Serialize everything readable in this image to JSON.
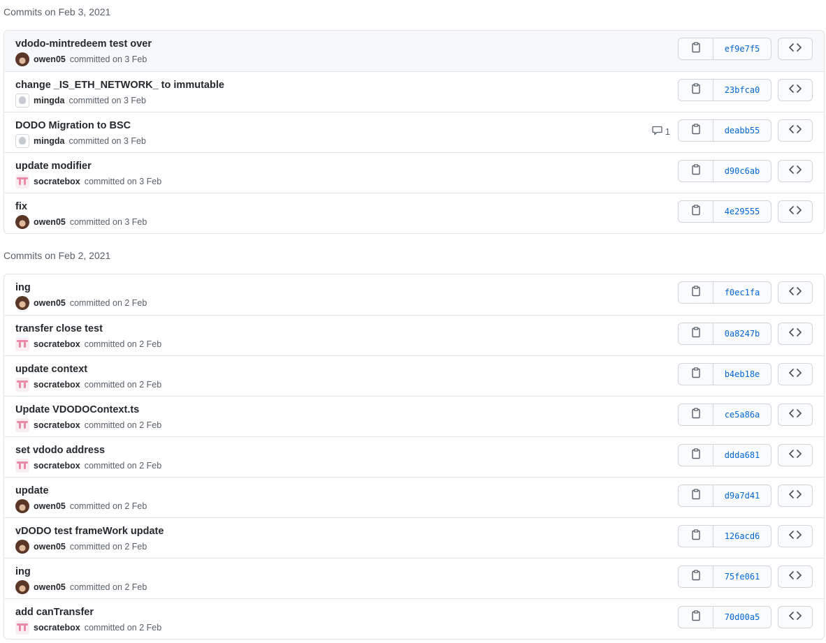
{
  "groups": [
    {
      "header": "Commits on Feb 3, 2021",
      "commits": [
        {
          "message": "vdodo-mintredeem test over",
          "author": "owen05",
          "committed": "committed on 3 Feb",
          "sha": "ef9e7f5",
          "avatar": "owen",
          "comments": "",
          "highlight": true
        },
        {
          "message": "change _IS_ETH_NETWORK_ to immutable",
          "author": "mingda",
          "committed": "committed on 3 Feb",
          "sha": "23bfca0",
          "avatar": "mingda",
          "comments": ""
        },
        {
          "message": "DODO Migration to BSC",
          "author": "mingda",
          "committed": "committed on 3 Feb",
          "sha": "deabb55",
          "avatar": "mingda",
          "comments": "1"
        },
        {
          "message": "update modifier",
          "author": "socratebox",
          "committed": "committed on 3 Feb",
          "sha": "d90c6ab",
          "avatar": "socrate",
          "comments": ""
        },
        {
          "message": "fix",
          "author": "owen05",
          "committed": "committed on 3 Feb",
          "sha": "4e29555",
          "avatar": "owen",
          "comments": ""
        }
      ]
    },
    {
      "header": "Commits on Feb 2, 2021",
      "commits": [
        {
          "message": "ing",
          "author": "owen05",
          "committed": "committed on 2 Feb",
          "sha": "f0ec1fa",
          "avatar": "owen",
          "comments": ""
        },
        {
          "message": "transfer close test",
          "author": "socratebox",
          "committed": "committed on 2 Feb",
          "sha": "0a8247b",
          "avatar": "socrate",
          "comments": ""
        },
        {
          "message": "update context",
          "author": "socratebox",
          "committed": "committed on 2 Feb",
          "sha": "b4eb18e",
          "avatar": "socrate",
          "comments": ""
        },
        {
          "message": "Update VDODOContext.ts",
          "author": "socratebox",
          "committed": "committed on 2 Feb",
          "sha": "ce5a86a",
          "avatar": "socrate",
          "comments": ""
        },
        {
          "message": "set vdodo address",
          "author": "socratebox",
          "committed": "committed on 2 Feb",
          "sha": "ddda681",
          "avatar": "socrate",
          "comments": ""
        },
        {
          "message": "update",
          "author": "owen05",
          "committed": "committed on 2 Feb",
          "sha": "d9a7d41",
          "avatar": "owen",
          "comments": ""
        },
        {
          "message": "vDODO test frameWork update",
          "author": "owen05",
          "committed": "committed on 2 Feb",
          "sha": "126acd6",
          "avatar": "owen",
          "comments": ""
        },
        {
          "message": "ing",
          "author": "owen05",
          "committed": "committed on 2 Feb",
          "sha": "75fe061",
          "avatar": "owen",
          "comments": ""
        },
        {
          "message": "add canTransfer",
          "author": "socratebox",
          "committed": "committed on 2 Feb",
          "sha": "70d00a5",
          "avatar": "socrate",
          "comments": ""
        }
      ]
    }
  ],
  "icons": {
    "copy": "clipboard-icon",
    "browse": "code-icon",
    "comment": "comment-icon"
  },
  "colors": {
    "sha_link": "#0366d6",
    "border": "#e1e4e8",
    "highlight_bg": "#f6f8fa"
  }
}
